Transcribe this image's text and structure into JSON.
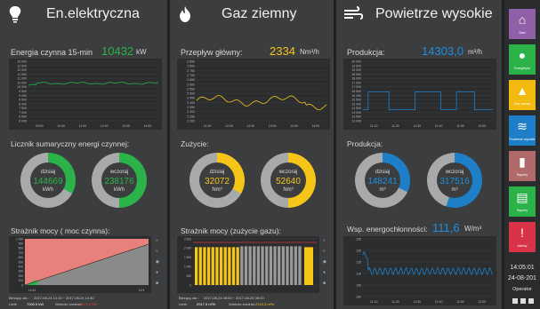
{
  "panel1": {
    "title": "En.elektryczna",
    "metric_label": "Energia czynna 15-min",
    "metric_value": "10432",
    "metric_unit": "kW",
    "yticks": [
      "13 000",
      "12 500",
      "12 000",
      "11 500",
      "11 000",
      "10 500",
      "10 000",
      "9 500",
      "9 000",
      "8 500",
      "8 000",
      "7 500",
      "7 000",
      "6 500",
      "6 000"
    ],
    "xticks": [
      "09:00",
      "10:00",
      "11:00",
      "12:00",
      "13:00",
      "14:00"
    ],
    "counter_title": "Licznik sumaryczny energi czynnej:",
    "today_label": "dzisiaj",
    "today_value": "144669",
    "today_unit": "kWh",
    "yesterday_label": "wczoraj",
    "yesterday_value": "238176",
    "yesterday_unit": "kWh",
    "guard_title": "Strażnik mocy ( moc czynna):",
    "guard_yticks": [
      "1 000",
      "900",
      "800",
      "700",
      "600",
      "500",
      "400",
      "300",
      "200",
      "100",
      "0"
    ],
    "guard_xticks": [
      "14:15",
      "14:5"
    ],
    "range_label": "Bieżący okr.:",
    "range_value": "2017-08-24 14:15  ÷  2017-08-24 14:30",
    "limit_label": "Limit:",
    "limit_value": "7000.0 kW",
    "forecast_label": "Wartość średnia:",
    "forecast_value": "4670.0 kW",
    "accent": "#2bb34a"
  },
  "panel2": {
    "title": "Gaz ziemny",
    "metric_label": "Przepływ główny:",
    "metric_value": "2334",
    "metric_unit": "Nm³/h",
    "yticks": [
      "2 850",
      "2 800",
      "2 750",
      "2 700",
      "2 650",
      "2 600",
      "2 550",
      "2 500",
      "2 450",
      "2 400",
      "2 350",
      "2 300",
      "2 250",
      "2 200"
    ],
    "xticks": [
      "11:30",
      "12:00",
      "12:30",
      "13:00",
      "13:30",
      "14:00"
    ],
    "counter_title": "Zużycie:",
    "today_label": "dzisiaj",
    "today_value": "32072",
    "today_unit": "Nm³",
    "yesterday_label": "wczoraj",
    "yesterday_value": "52640",
    "yesterday_unit": "Nm³",
    "guard_title": "Strażnik mocy (zużycie gazu):",
    "guard_yticks": [
      "2 500",
      "2 000",
      "1 500",
      "1 000",
      "500",
      "0"
    ],
    "range_label": "Bieżący okr.:",
    "range_value": "2017-08-24 08:00  ÷  2017-08-25 08:00",
    "limit_label": "Limit:",
    "limit_value": "2917.0 m³/h",
    "forecast_label": "Wartość średnia:",
    "forecast_value": "2315.3 m³/h",
    "accent": "#f5c518"
  },
  "panel3": {
    "title": "Powietrze wysokie",
    "metric_label": "Produkcja:",
    "metric_value": "14303,0",
    "metric_unit": "m³/h",
    "yticks": [
      "20 000",
      "19 500",
      "19 000",
      "18 500",
      "18 000",
      "17 500",
      "17 000",
      "16 500",
      "16 000",
      "15 500",
      "15 000",
      "14 500",
      "14 000",
      "13 500",
      "13 000"
    ],
    "xticks": [
      "11:10",
      "11:20",
      "11:30",
      "11:40",
      "11:50",
      "12:00"
    ],
    "counter_title": "Produkcja:",
    "today_label": "dzisiaj",
    "today_value": "148241",
    "today_unit": "m³",
    "yesterday_label": "wczoraj",
    "yesterday_value": "317516",
    "yesterday_unit": "m³",
    "eff_label": "Wsp. energochłonności:",
    "eff_value": "111,6",
    "eff_unit": "W/m³",
    "eff_yticks": [
      "125",
      "120",
      "115",
      "110",
      "105",
      "100"
    ],
    "eff_xticks": [
      "11:10",
      "11:20",
      "11:30",
      "11:40",
      "11:50",
      "12:00"
    ],
    "accent": "#1e7fc8"
  },
  "sidebar": {
    "items": [
      {
        "label": "Start",
        "color": "#8f5fa8",
        "icon": "home-icon"
      },
      {
        "label": "Energetyka",
        "color": "#2bb34a",
        "icon": "bulb-icon"
      },
      {
        "label": "Gaz ziemny",
        "color": "#f2b90f",
        "icon": "flame-icon"
      },
      {
        "label": "Powietrze wysokie",
        "color": "#1e7fc8",
        "icon": "wind-icon"
      },
      {
        "label": "Raporty",
        "color": "#b06a6a",
        "icon": "bar-chart-icon"
      },
      {
        "label": "Raporty",
        "color": "#2bb34a",
        "icon": "report-icon"
      },
      {
        "label": "Alarmy",
        "color": "#d9334a",
        "icon": "alert-icon"
      }
    ],
    "time": "14:05:01",
    "date": "24-08-201",
    "user": "Operator"
  }
}
